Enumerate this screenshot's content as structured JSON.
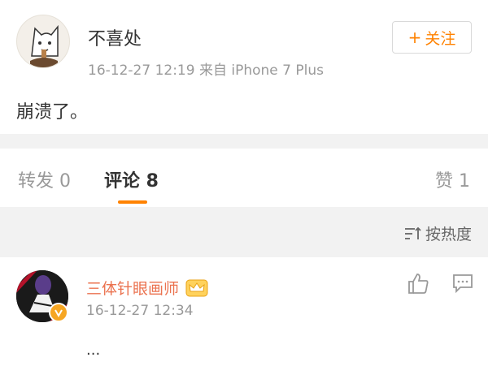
{
  "post": {
    "username": "不喜处",
    "meta": "16-12-27 12:19  来自 iPhone 7 Plus",
    "follow_label": "关注",
    "content": "崩溃了。"
  },
  "tabs": {
    "repost": "转发 0",
    "comments": "评论 8",
    "likes": "赞 1"
  },
  "sort": {
    "label": "按热度"
  },
  "comment": {
    "username": "三体针眼画师",
    "time": "16-12-27 12:34",
    "text": "..."
  },
  "colors": {
    "accent": "#ff8200",
    "name": "#eb7350",
    "muted": "#999999"
  }
}
